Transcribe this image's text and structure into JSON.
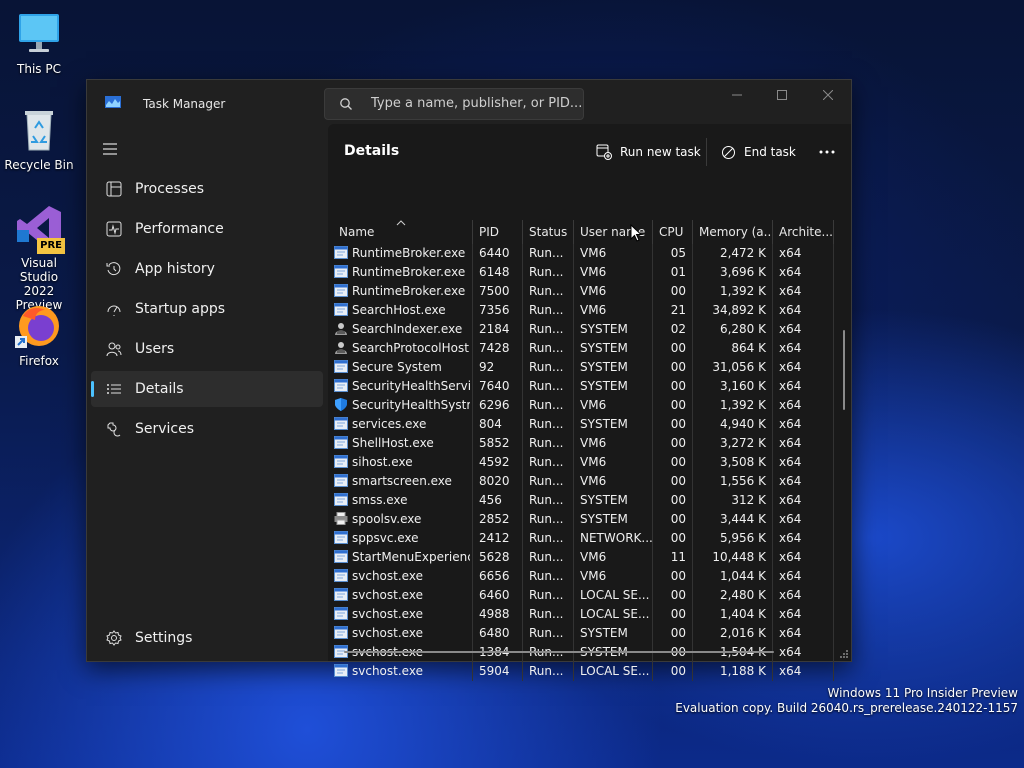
{
  "desktop": {
    "icons": [
      {
        "label": "This PC"
      },
      {
        "label": "Recycle Bin"
      },
      {
        "label": "Visual Studio 2022 Preview",
        "line1": "Visual Studio",
        "line2": "2022 Preview",
        "badge": "PRE"
      },
      {
        "label": "Firefox"
      }
    ],
    "watermark": {
      "line1": "Windows 11 Pro Insider Preview",
      "line2": "Evaluation copy. Build 26040.rs_prerelease.240122-1157"
    }
  },
  "window": {
    "title": "Task Manager",
    "search_placeholder": "Type a name, publisher, or PID...",
    "nav": [
      {
        "label": "Processes",
        "icon": "processes-icon"
      },
      {
        "label": "Performance",
        "icon": "performance-icon"
      },
      {
        "label": "App history",
        "icon": "app-history-icon"
      },
      {
        "label": "Startup apps",
        "icon": "startup-apps-icon"
      },
      {
        "label": "Users",
        "icon": "users-icon"
      },
      {
        "label": "Details",
        "icon": "details-icon",
        "active": true
      },
      {
        "label": "Services",
        "icon": "services-icon"
      }
    ],
    "settings_label": "Settings",
    "page_title": "Details",
    "toolbar": {
      "run_new_task": "Run new task",
      "end_task": "End task"
    },
    "columns": [
      "Name",
      "PID",
      "Status",
      "User name",
      "CPU",
      "Memory (a...",
      "Archite..."
    ],
    "rows": [
      {
        "name": "RuntimeBroker.exe",
        "pid": "6440",
        "status": "Run...",
        "user": "VM6",
        "cpu": "05",
        "mem": "2,472 K",
        "arch": "x64",
        "icon": "window"
      },
      {
        "name": "RuntimeBroker.exe",
        "pid": "6148",
        "status": "Run...",
        "user": "VM6",
        "cpu": "01",
        "mem": "3,696 K",
        "arch": "x64",
        "icon": "window"
      },
      {
        "name": "RuntimeBroker.exe",
        "pid": "7500",
        "status": "Run...",
        "user": "VM6",
        "cpu": "00",
        "mem": "1,392 K",
        "arch": "x64",
        "icon": "window"
      },
      {
        "name": "SearchHost.exe",
        "pid": "7356",
        "status": "Run...",
        "user": "VM6",
        "cpu": "21",
        "mem": "34,892 K",
        "arch": "x64",
        "icon": "window"
      },
      {
        "name": "SearchIndexer.exe",
        "pid": "2184",
        "status": "Run...",
        "user": "SYSTEM",
        "cpu": "02",
        "mem": "6,280 K",
        "arch": "x64",
        "icon": "person"
      },
      {
        "name": "SearchProtocolHost....",
        "pid": "7428",
        "status": "Run...",
        "user": "SYSTEM",
        "cpu": "00",
        "mem": "864 K",
        "arch": "x64",
        "icon": "person"
      },
      {
        "name": "Secure System",
        "pid": "92",
        "status": "Run...",
        "user": "SYSTEM",
        "cpu": "00",
        "mem": "31,056 K",
        "arch": "x64",
        "icon": "window"
      },
      {
        "name": "SecurityHealthServic...",
        "pid": "7640",
        "status": "Run...",
        "user": "SYSTEM",
        "cpu": "00",
        "mem": "3,160 K",
        "arch": "x64",
        "icon": "window"
      },
      {
        "name": "SecurityHealthSystra...",
        "pid": "6296",
        "status": "Run...",
        "user": "VM6",
        "cpu": "00",
        "mem": "1,392 K",
        "arch": "x64",
        "icon": "shield"
      },
      {
        "name": "services.exe",
        "pid": "804",
        "status": "Run...",
        "user": "SYSTEM",
        "cpu": "00",
        "mem": "4,940 K",
        "arch": "x64",
        "icon": "window"
      },
      {
        "name": "ShellHost.exe",
        "pid": "5852",
        "status": "Run...",
        "user": "VM6",
        "cpu": "00",
        "mem": "3,272 K",
        "arch": "x64",
        "icon": "window"
      },
      {
        "name": "sihost.exe",
        "pid": "4592",
        "status": "Run...",
        "user": "VM6",
        "cpu": "00",
        "mem": "3,508 K",
        "arch": "x64",
        "icon": "window"
      },
      {
        "name": "smartscreen.exe",
        "pid": "8020",
        "status": "Run...",
        "user": "VM6",
        "cpu": "00",
        "mem": "1,556 K",
        "arch": "x64",
        "icon": "window"
      },
      {
        "name": "smss.exe",
        "pid": "456",
        "status": "Run...",
        "user": "SYSTEM",
        "cpu": "00",
        "mem": "312 K",
        "arch": "x64",
        "icon": "window"
      },
      {
        "name": "spoolsv.exe",
        "pid": "2852",
        "status": "Run...",
        "user": "SYSTEM",
        "cpu": "00",
        "mem": "3,444 K",
        "arch": "x64",
        "icon": "printer"
      },
      {
        "name": "sppsvc.exe",
        "pid": "2412",
        "status": "Run...",
        "user": "NETWORK...",
        "cpu": "00",
        "mem": "5,956 K",
        "arch": "x64",
        "icon": "window"
      },
      {
        "name": "StartMenuExperienc...",
        "pid": "5628",
        "status": "Run...",
        "user": "VM6",
        "cpu": "11",
        "mem": "10,448 K",
        "arch": "x64",
        "icon": "window"
      },
      {
        "name": "svchost.exe",
        "pid": "6656",
        "status": "Run...",
        "user": "VM6",
        "cpu": "00",
        "mem": "1,044 K",
        "arch": "x64",
        "icon": "window"
      },
      {
        "name": "svchost.exe",
        "pid": "6460",
        "status": "Run...",
        "user": "LOCAL SE...",
        "cpu": "00",
        "mem": "2,480 K",
        "arch": "x64",
        "icon": "window"
      },
      {
        "name": "svchost.exe",
        "pid": "4988",
        "status": "Run...",
        "user": "LOCAL SE...",
        "cpu": "00",
        "mem": "1,404 K",
        "arch": "x64",
        "icon": "window"
      },
      {
        "name": "svchost.exe",
        "pid": "6480",
        "status": "Run...",
        "user": "SYSTEM",
        "cpu": "00",
        "mem": "2,016 K",
        "arch": "x64",
        "icon": "window"
      },
      {
        "name": "svchost.exe",
        "pid": "1384",
        "status": "Run...",
        "user": "SYSTEM",
        "cpu": "00",
        "mem": "1,504 K",
        "arch": "x64",
        "icon": "window"
      },
      {
        "name": "svchost.exe",
        "pid": "5904",
        "status": "Run...",
        "user": "LOCAL SE...",
        "cpu": "00",
        "mem": "1,188 K",
        "arch": "x64",
        "icon": "window"
      }
    ]
  },
  "colors": {
    "accent": "#4cc2ff",
    "window_bg": "#202020",
    "content_bg": "#191919"
  }
}
